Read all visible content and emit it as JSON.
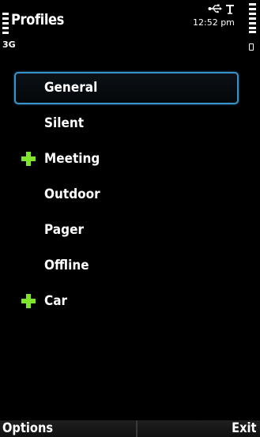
{
  "status_bar": {
    "signal_icon": "signal-strength-icon",
    "network": "3G",
    "usb_icon": "usb-icon",
    "antenna_icon": "antenna-icon",
    "time": "12:52 pm",
    "battery_icon": "battery-level-icon"
  },
  "header": {
    "title": "Profiles"
  },
  "profiles": [
    {
      "label": "General",
      "selected": true,
      "marked": false
    },
    {
      "label": "Silent",
      "selected": false,
      "marked": false
    },
    {
      "label": "Meeting",
      "selected": false,
      "marked": true
    },
    {
      "label": "Outdoor",
      "selected": false,
      "marked": false
    },
    {
      "label": "Pager",
      "selected": false,
      "marked": false
    },
    {
      "label": "Offline",
      "selected": false,
      "marked": false
    },
    {
      "label": "Car",
      "selected": false,
      "marked": true
    }
  ],
  "softkeys": {
    "left": "Options",
    "right": "Exit"
  },
  "colors": {
    "background": "#000000",
    "highlight_border": "#3a93c8",
    "marker": "#7ee52b",
    "text": "#ffffff"
  }
}
